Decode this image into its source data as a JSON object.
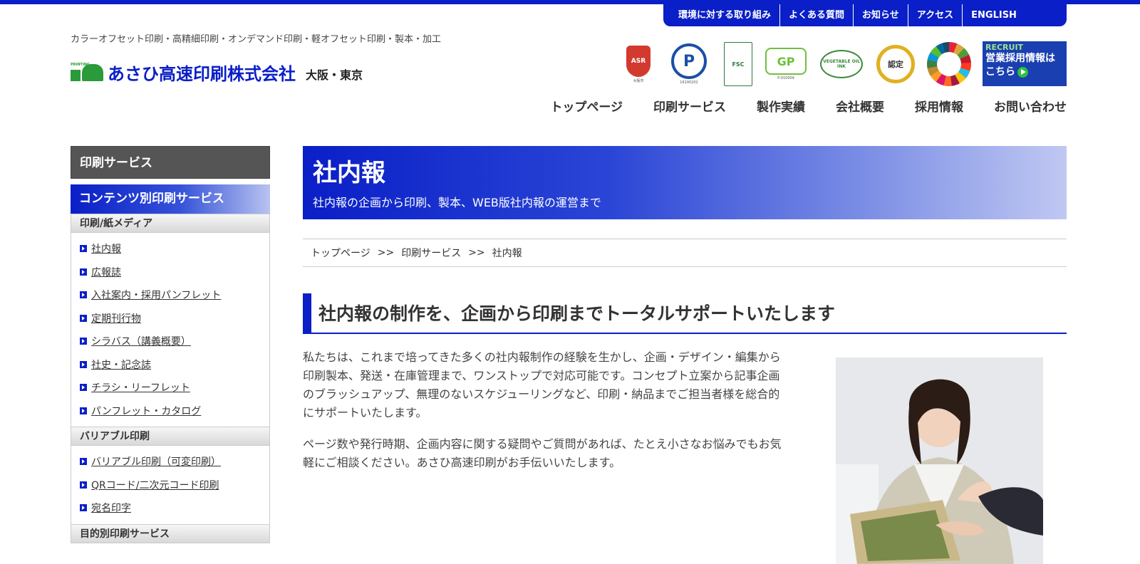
{
  "util_nav": [
    "環境に対する取り組み",
    "よくある質問",
    "お知らせ",
    "アクセス",
    "ENGLISH"
  ],
  "header": {
    "tagline": "カラーオフセット印刷・高精細印刷・オンデマンド印刷・軽オフセット印刷・製本・加工",
    "logo_small": "PRINTING",
    "company_name": "あさひ高速印刷株式会社",
    "locations": "大阪・東京"
  },
  "badges": {
    "asr": "ASR",
    "privacy": "P",
    "fsc": "FSC",
    "vegetable_oil": "VEGETABLE OIL INK",
    "nintei": "認定",
    "gp": "GP"
  },
  "recruit": {
    "label": "RECRUIT",
    "line1": "営業採用情報は",
    "line2": "こちら"
  },
  "main_nav": [
    "トップページ",
    "印刷サービス",
    "製作実績",
    "会社概要",
    "採用情報",
    "お問い合わせ"
  ],
  "sidebar": {
    "heading": "印刷サービス",
    "subheading": "コンテンツ別印刷サービス",
    "categories": [
      {
        "title": "印刷/紙メディア",
        "items": [
          "社内報",
          "広報誌",
          "入社案内・採用パンフレット",
          "定期刊行物",
          "シラバス（講義概要）",
          "社史・記念誌",
          "チラシ・リーフレット",
          "パンフレット・カタログ"
        ]
      },
      {
        "title": "バリアブル印刷",
        "items": [
          "バリアブル印刷（可変印刷）",
          "QRコード/二次元コード印刷",
          "宛名印字"
        ]
      },
      {
        "title": "目的別印刷サービス",
        "items": []
      }
    ]
  },
  "hero": {
    "title": "社内報",
    "subtitle": "社内報の企画から印刷、製本、WEB版社内報の運営まで"
  },
  "breadcrumb": {
    "items": [
      "トップページ",
      "印刷サービス",
      "社内報"
    ],
    "separator": ">>"
  },
  "section": {
    "title": "社内報の制作を、企画から印刷までトータルサポートいたします",
    "paragraphs": [
      "私たちは、これまで培ってきた多くの社内報制作の経験を生かし、企画・デザイン・編集から印刷製本、発送・在庫管理まで、ワンストップで対応可能です。コンセプト立案から記事企画のブラッシュアップ、無理のないスケジューリングなど、印刷・納品までご担当者様を総合的にサポートいたします。",
      "ページ数や発行時期、企画内容に関する疑問やご質問があれば、たとえ小さなお悩みでもお気軽にご相談ください。あさひ高速印刷がお手伝いいたします。"
    ]
  },
  "colors": {
    "brand_blue": "#0a1fc7",
    "logo_green": "#2a9a3a",
    "sidebar_dark": "#555555"
  }
}
